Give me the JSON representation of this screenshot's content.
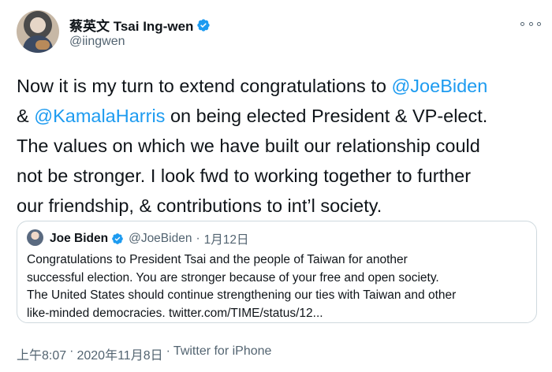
{
  "author": {
    "display_name": "蔡英文 Tsai Ing-wen",
    "handle": "@iingwen",
    "verified": true
  },
  "more_icon": "more-horizontal-icon",
  "tweet": {
    "lines": [
      {
        "t1": "Now it is my turn to extend congratulations to ",
        "m1": "@JoeBiden"
      },
      {
        "t0": "& ",
        "m1": "@KamalaHarris",
        "t1": " on being elected President & VP-elect."
      },
      {
        "t1": "The values on which we have built our relationship could"
      },
      {
        "t1": "not be stronger. I look fwd to working together to further"
      },
      {
        "t1": "our friendship, & contributions to int’l society."
      }
    ]
  },
  "quote": {
    "display_name": "Joe Biden",
    "handle": "@JoeBiden",
    "separator": "·",
    "date": "1月12日",
    "lines": [
      "Congratulations to President Tsai and the people of Taiwan for another",
      "successful election. You are stronger because of your free and open society.",
      "The United States should continue strengthening our ties with Taiwan and other",
      "like-minded democracies. twitter.com/TIME/status/12..."
    ]
  },
  "footer": {
    "time": "上午8:07",
    "separator": "·",
    "date": "2020年11月8日",
    "source": "Twitter for iPhone"
  },
  "colors": {
    "link": "#1d9bf0",
    "secondary_text": "#536471",
    "border": "#cfd9de"
  }
}
